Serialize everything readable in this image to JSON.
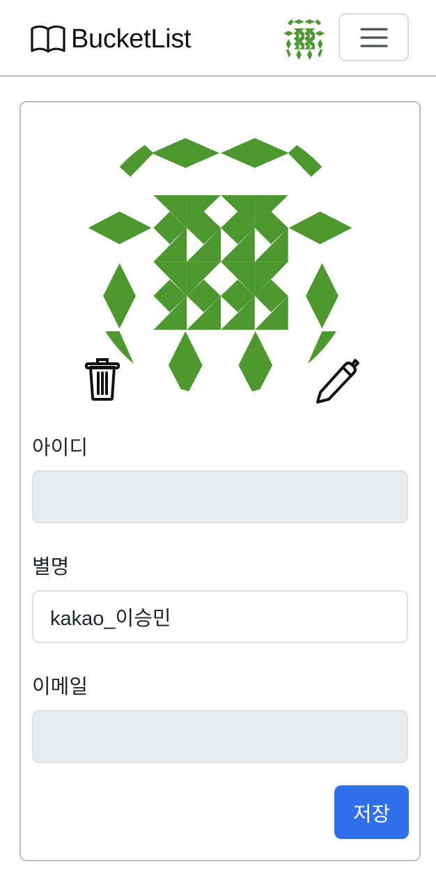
{
  "navbar": {
    "brand": "BucketList",
    "brand_icon": "open-book-icon",
    "avatar_icon": "identicon-avatar",
    "menu_icon": "hamburger-menu-icon"
  },
  "profile": {
    "avatar_icon": "identicon-avatar",
    "avatar_color": "#4c972e",
    "delete_icon": "trash-icon",
    "edit_icon": "pencil-icon"
  },
  "form": {
    "id_label": "아이디",
    "id_value": "",
    "nickname_label": "별명",
    "nickname_value": "kakao_이승민",
    "email_label": "이메일",
    "email_value": "",
    "save_label": "저장"
  },
  "colors": {
    "primary": "#2f6fec",
    "disabled_bg": "#e9ecef"
  }
}
